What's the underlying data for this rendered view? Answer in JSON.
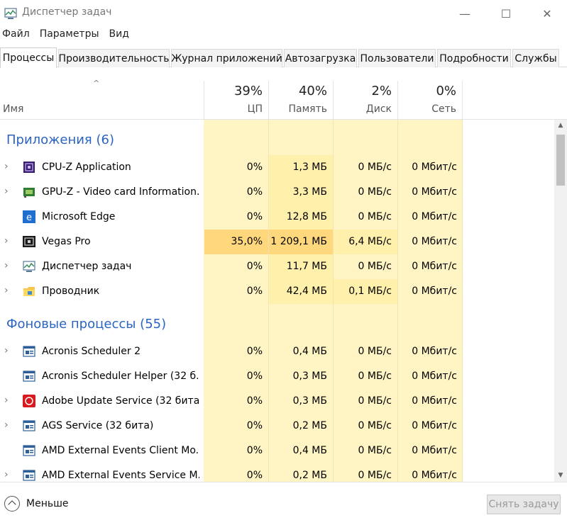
{
  "window": {
    "title": "Диспетчер задач",
    "min_glyph": "—",
    "max_glyph": "☐",
    "close_glyph": "✕"
  },
  "menu": [
    "Файл",
    "Параметры",
    "Вид"
  ],
  "tabs": [
    "Процессы",
    "Производительность",
    "Журнал приложений",
    "Автозагрузка",
    "Пользователи",
    "Подробности",
    "Службы"
  ],
  "header": {
    "sort_glyph": "^",
    "name_label": "Имя",
    "columns": [
      {
        "pct": "39%",
        "label": "ЦП"
      },
      {
        "pct": "40%",
        "label": "Память"
      },
      {
        "pct": "2%",
        "label": "Диск"
      },
      {
        "pct": "0%",
        "label": "Сеть"
      }
    ]
  },
  "glyphs": {
    "chevron": "›",
    "scroll_up": "▲",
    "scroll_down": "▼"
  },
  "groups": [
    {
      "title": "Приложения (6)",
      "rows": [
        {
          "name": "CPU-Z Application",
          "icon": "cpuz-icon",
          "expandable": true,
          "cpu": "0%",
          "mem": "1,3 МБ",
          "disk": "0 МБ/с",
          "net": "0 Мбит/с",
          "heat": [
            "",
            "mid",
            "",
            ""
          ]
        },
        {
          "name": "GPU-Z - Video card Information...",
          "icon": "gpuz-icon",
          "expandable": true,
          "cpu": "0%",
          "mem": "3,3 МБ",
          "disk": "0 МБ/с",
          "net": "0 Мбит/с",
          "heat": [
            "",
            "mid",
            "",
            ""
          ]
        },
        {
          "name": "Microsoft Edge",
          "icon": "edge-icon",
          "expandable": false,
          "cpu": "0%",
          "mem": "12,8 МБ",
          "disk": "0 МБ/с",
          "net": "0 Мбит/с",
          "heat": [
            "",
            "mid",
            "",
            ""
          ]
        },
        {
          "name": "Vegas Pro",
          "icon": "vegas-icon",
          "expandable": true,
          "cpu": "35,0%",
          "mem": "1 209,1 МБ",
          "disk": "6,4 МБ/с",
          "net": "0 Мбит/с",
          "heat": [
            "hot",
            "hot",
            "mid",
            ""
          ]
        },
        {
          "name": "Диспетчер задач",
          "icon": "taskmgr-icon",
          "expandable": true,
          "cpu": "0%",
          "mem": "11,7 МБ",
          "disk": "0 МБ/с",
          "net": "0 Мбит/с",
          "heat": [
            "",
            "mid",
            "",
            ""
          ]
        },
        {
          "name": "Проводник",
          "icon": "explorer-icon",
          "expandable": true,
          "cpu": "0%",
          "mem": "42,4 МБ",
          "disk": "0,1 МБ/с",
          "net": "0 Мбит/с",
          "heat": [
            "",
            "mid",
            "mid",
            ""
          ]
        }
      ]
    },
    {
      "title": "Фоновые процессы (55)",
      "rows": [
        {
          "name": "Acronis Scheduler 2",
          "icon": "service-window-icon",
          "expandable": true,
          "cpu": "0%",
          "mem": "0,4 МБ",
          "disk": "0 МБ/с",
          "net": "0 Мбит/с",
          "heat": [
            "",
            "",
            "",
            ""
          ]
        },
        {
          "name": "Acronis Scheduler Helper (32 б...",
          "icon": "service-window-icon",
          "expandable": false,
          "cpu": "0%",
          "mem": "0,3 МБ",
          "disk": "0 МБ/с",
          "net": "0 Мбит/с",
          "heat": [
            "",
            "",
            "",
            ""
          ]
        },
        {
          "name": "Adobe Update Service (32 бита)",
          "icon": "adobe-icon",
          "expandable": true,
          "cpu": "0%",
          "mem": "0,3 МБ",
          "disk": "0 МБ/с",
          "net": "0 Мбит/с",
          "heat": [
            "",
            "",
            "",
            ""
          ]
        },
        {
          "name": "AGS Service (32 бита)",
          "icon": "service-window-icon",
          "expandable": true,
          "cpu": "0%",
          "mem": "0,2 МБ",
          "disk": "0 МБ/с",
          "net": "0 Мбит/с",
          "heat": [
            "",
            "",
            "",
            ""
          ]
        },
        {
          "name": "AMD External Events Client Mo...",
          "icon": "service-window-icon",
          "expandable": false,
          "cpu": "0%",
          "mem": "0,4 МБ",
          "disk": "0 МБ/с",
          "net": "0 Мбит/с",
          "heat": [
            "",
            "",
            "",
            ""
          ]
        },
        {
          "name": "AMD External Events Service M...",
          "icon": "service-window-icon",
          "expandable": true,
          "cpu": "0%",
          "mem": "0,2 МБ",
          "disk": "0 МБ/с",
          "net": "0 Мбит/с",
          "heat": [
            "",
            "",
            "",
            ""
          ]
        }
      ]
    }
  ],
  "footer": {
    "less_label": "Меньше",
    "end_task_label": "Снять задачу"
  },
  "colors": {
    "heat_base": "#fff4c4",
    "heat_mid": "#fff0ab",
    "heat_hot": "#ffd77c",
    "group_title": "#2b64c2"
  }
}
